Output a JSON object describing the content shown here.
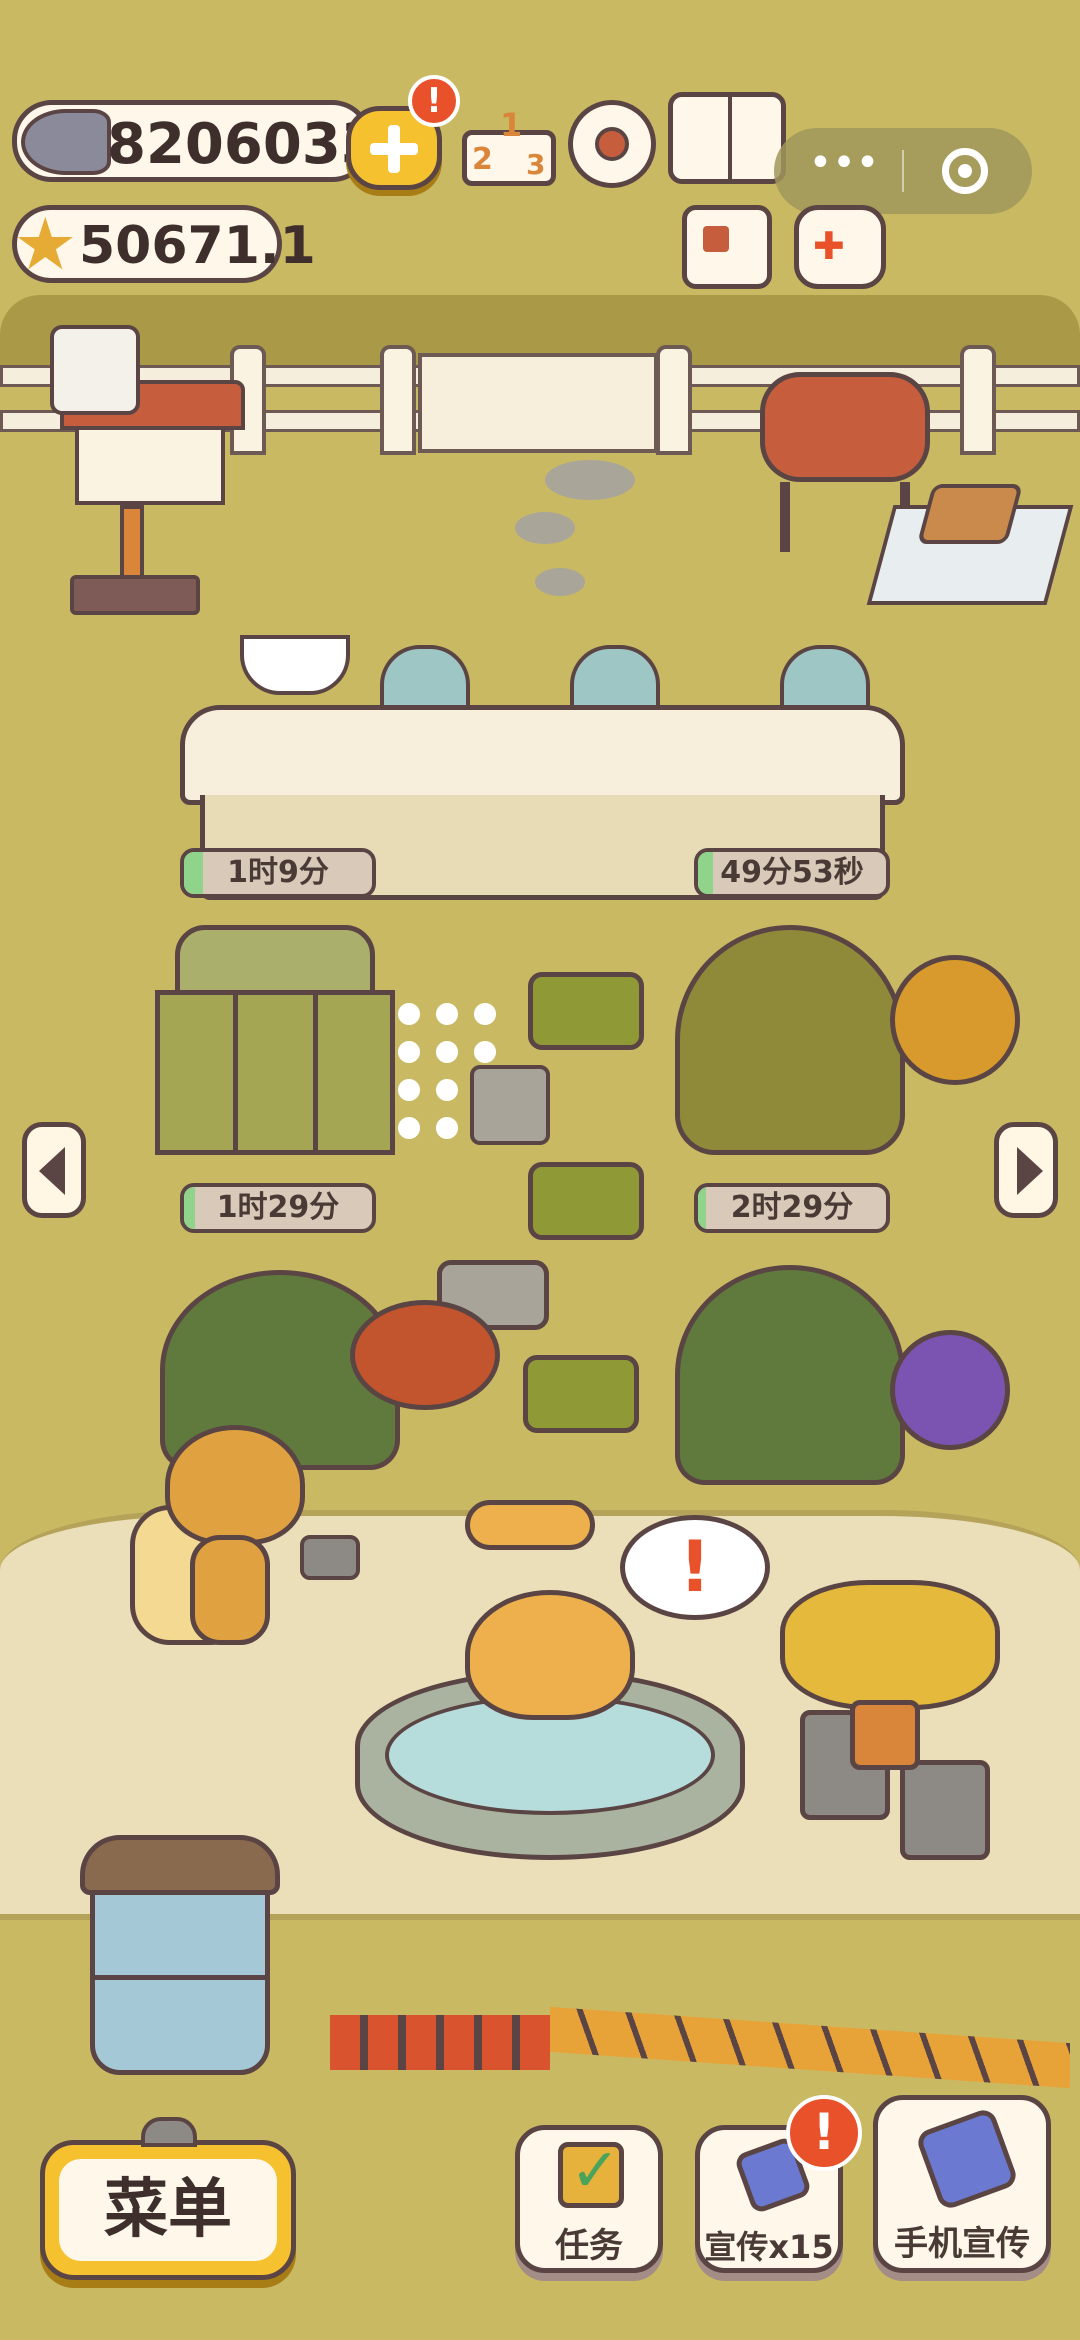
{
  "currency": {
    "fish": "82060330",
    "stars": "50671.1"
  },
  "badges": {
    "plus": "!",
    "promo": "!",
    "speech": "!"
  },
  "timers": [
    {
      "label": "1时9分",
      "progress": 0.1
    },
    {
      "label": "49分53秒",
      "progress": 0.08
    },
    {
      "label": "1时29分",
      "progress": 0.06
    },
    {
      "label": "2时29分",
      "progress": 0.04
    }
  ],
  "ranking_digits": [
    "1",
    "2",
    "3"
  ],
  "bottom": {
    "menu": "菜单",
    "task": "任务",
    "promote": "宣传x15",
    "phone_promote": "手机宣传"
  },
  "colors": {
    "ground": "#c9b963",
    "path": "#eadfb8",
    "accent": "#f6c12f",
    "badge": "#e8512a",
    "outline": "#5a4544"
  },
  "icons": [
    "fish-icon",
    "plus-icon",
    "ranking-icon",
    "gear-icon",
    "book-icon",
    "more-icon",
    "target-icon",
    "star-icon",
    "newspaper-icon",
    "gamepad-icon",
    "checklist-icon",
    "phone-icon",
    "arrow-left-icon",
    "arrow-right-icon"
  ]
}
